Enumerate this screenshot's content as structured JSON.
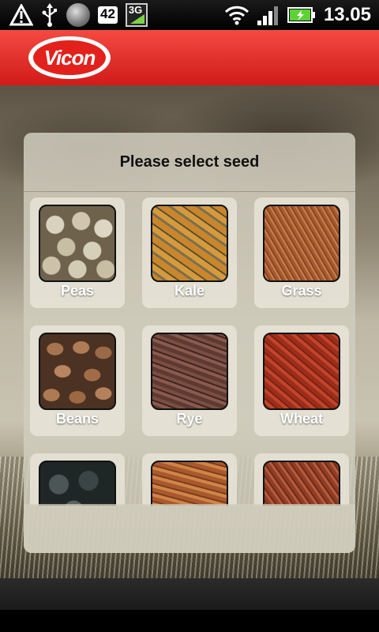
{
  "status_bar": {
    "notification_count": "42",
    "network_type": "3G",
    "time": "13.05",
    "icons": [
      "warning-icon",
      "usb-icon",
      "disc-icon",
      "wifi-icon",
      "signal-icon",
      "battery-icon"
    ]
  },
  "header": {
    "logo_text": "Vicon",
    "brand_color": "#e3211c"
  },
  "dialog": {
    "title": "Please select seed",
    "seeds": [
      {
        "label": "Peas"
      },
      {
        "label": "Kale"
      },
      {
        "label": "Grass"
      },
      {
        "label": "Beans"
      },
      {
        "label": "Rye"
      },
      {
        "label": "Wheat"
      }
    ]
  }
}
